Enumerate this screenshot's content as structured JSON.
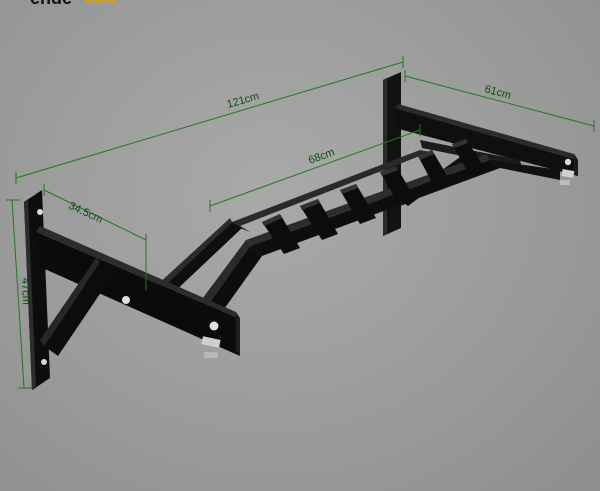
{
  "logo": {
    "text": "ende",
    "accent": "■■■"
  },
  "dimensions": {
    "overall_length": "121cm",
    "depth": "61cm",
    "grip_length": "68cm",
    "bracket_offset": "34.5cm",
    "height": "47cm"
  },
  "colors": {
    "background": "#9a9a9a",
    "frame": "#0d0d0d",
    "dimension_line": "#1f7a1f",
    "bolt": "#d9d9d9"
  }
}
